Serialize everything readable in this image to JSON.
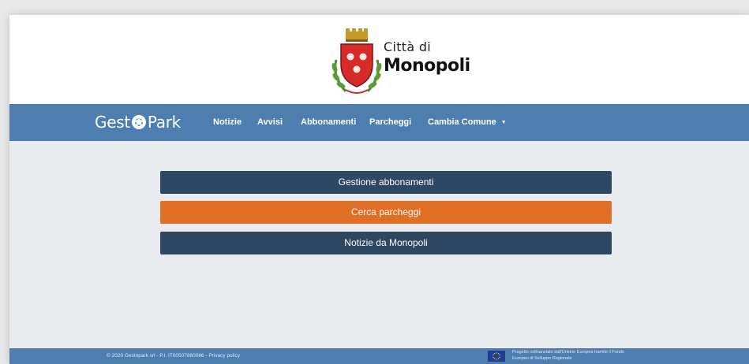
{
  "header": {
    "city_prefix": "Città di",
    "city_name": "Monopoli"
  },
  "brand": {
    "part1": "Gest",
    "part2": "Park"
  },
  "nav": {
    "items": [
      {
        "label": "Notizie"
      },
      {
        "label": "Avvisi"
      },
      {
        "label": "Abbonamenti"
      },
      {
        "label": "Parcheggi"
      },
      {
        "label": "Cambia Comune"
      }
    ]
  },
  "actions": {
    "subscriptions": "Gestione abbonamenti",
    "search_parking": "Cerca parcheggi",
    "news": "Notizie da Monopoli"
  },
  "footer": {
    "left_text": "© 2020 Gestopark srl - P.I. IT00507860086 - Privacy policy",
    "eu_line1": "Progetto cofinanziato dall'Unione Europea tramite il Fondo",
    "eu_line2": "Europeo di Sviluppo Regionale"
  },
  "colors": {
    "navbar": "#4d7eaf",
    "button_dark": "#2e4762",
    "button_accent": "#e06e25",
    "page_bg": "#e9ecef"
  }
}
